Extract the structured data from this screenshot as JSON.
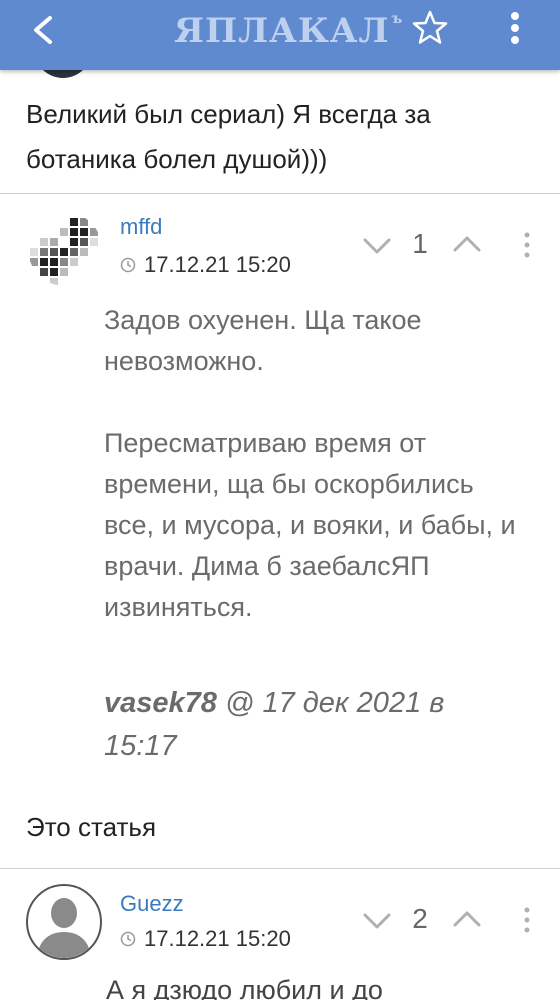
{
  "header": {
    "logo_text": "ЯПЛАКАЛ",
    "logo_superscript": "ъ",
    "bar_color": "#5f8ad0",
    "icons": {
      "back": "chevron-left-icon",
      "favorite": "star-outline-icon",
      "menu": "kebab-menu-icon"
    }
  },
  "previous_comment": {
    "text": "Великий был сериал) Я всегда за ботаника болел душой)))"
  },
  "comments": [
    {
      "username": "mffd",
      "timestamp": "17.12.21 15:20",
      "votes": "1",
      "body": "Задов охуенен. Ща такое невозможно.\n\nПересматриваю время от времени, ща бы оскорбились все, и мусора, и вояки, и бабы, и врачи. Дима б заебалсЯП извиняться.",
      "quote_author": "vasek78",
      "quote_meta": " @ 17 дек 2021 в 15:17"
    },
    {
      "username": "Guezz",
      "timestamp": "17.12.21 15:20",
      "votes": "2",
      "body_cut": "А я дзюдо любил и до"
    }
  ],
  "between_text": "Это статья",
  "colors": {
    "username": "#3a7bbf",
    "body_text": "#6b6b6b",
    "divider": "#cfcfcf"
  }
}
